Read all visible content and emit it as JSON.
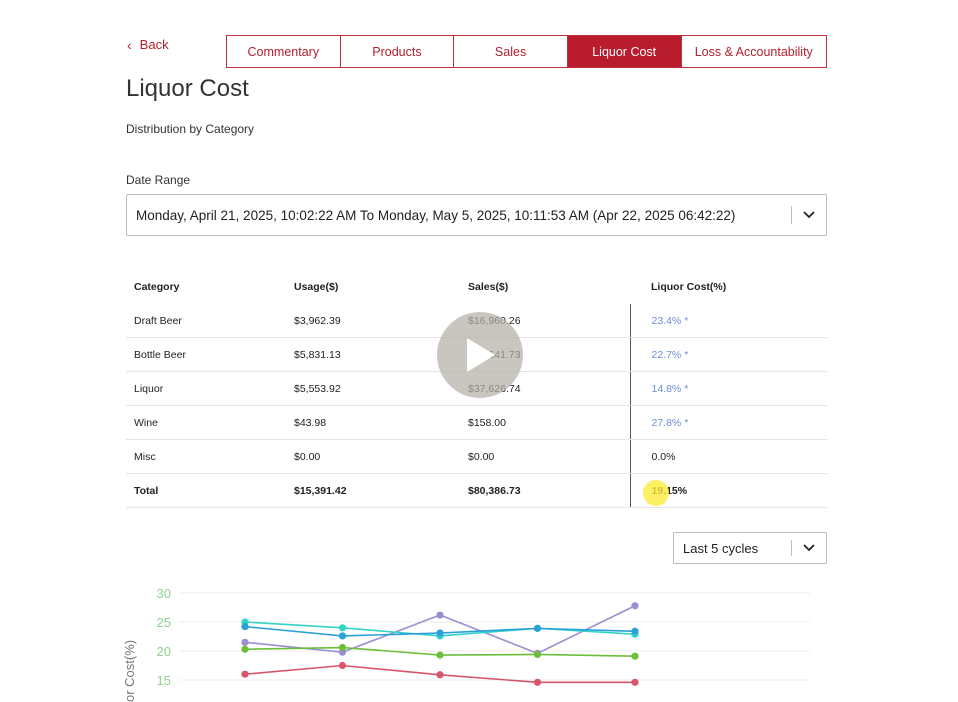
{
  "nav": {
    "back_label": "Back",
    "tabs": [
      {
        "label": "Commentary",
        "active": false
      },
      {
        "label": "Products",
        "active": false
      },
      {
        "label": "Sales",
        "active": false
      },
      {
        "label": "Liquor Cost",
        "active": true
      },
      {
        "label": "Loss & Accountability",
        "active": false
      }
    ]
  },
  "page": {
    "title": "Liquor Cost",
    "subtitle": "Distribution by Category"
  },
  "date_range": {
    "label": "Date Range",
    "value": "Monday, April 21, 2025, 10:02:22 AM To Monday, May 5, 2025, 10:11:53 AM (Apr 22, 2025 06:42:22)"
  },
  "table": {
    "headers": [
      "Category",
      "Usage($)",
      "Sales($)",
      "Liquor Cost(%)"
    ],
    "rows": [
      {
        "category": "Draft Beer",
        "usage": "$3,962.39",
        "sales": "$16,960.26",
        "cost": "23.4% *"
      },
      {
        "category": "Bottle Beer",
        "usage": "$5,831.13",
        "sales": "$25,641.73",
        "cost": "22.7% *"
      },
      {
        "category": "Liquor",
        "usage": "$5,553.92",
        "sales": "$37,626.74",
        "cost": "14.8% *"
      },
      {
        "category": "Wine",
        "usage": "$43.98",
        "sales": "$158.00",
        "cost": "27.8% *"
      },
      {
        "category": "Misc",
        "usage": "$0.00",
        "sales": "$0.00",
        "cost": "0.0%"
      }
    ],
    "total": {
      "category": "Total",
      "usage": "$15,391.42",
      "sales": "$80,386.73",
      "cost": "19.15%"
    }
  },
  "cycles": {
    "value": "Last 5 cycles"
  },
  "colors": {
    "accent": "#b81c2d",
    "link": "#6a8fd8",
    "axis_tick": "#8fd18f"
  },
  "chart_data": {
    "type": "line",
    "ylabel": "or Cost(%)",
    "yticks": [
      15,
      20,
      25,
      30
    ],
    "ylim": [
      13,
      32
    ],
    "x": [
      1,
      2,
      3,
      4,
      5
    ],
    "grid": true,
    "series": [
      {
        "color": "#9b8fd4",
        "values": [
          21.5,
          19.8,
          26.2,
          19.6,
          27.8
        ]
      },
      {
        "color": "#34d3c8",
        "values": [
          25.0,
          24.0,
          22.6,
          23.9,
          22.9
        ]
      },
      {
        "color": "#2aa0d8",
        "values": [
          24.2,
          22.6,
          23.1,
          23.9,
          23.4
        ]
      },
      {
        "color": "#6dbf3a",
        "values": [
          20.3,
          20.6,
          19.3,
          19.4,
          19.1
        ]
      },
      {
        "color": "#d9556a",
        "values": [
          16.0,
          17.5,
          15.9,
          14.6,
          14.6
        ]
      }
    ]
  }
}
